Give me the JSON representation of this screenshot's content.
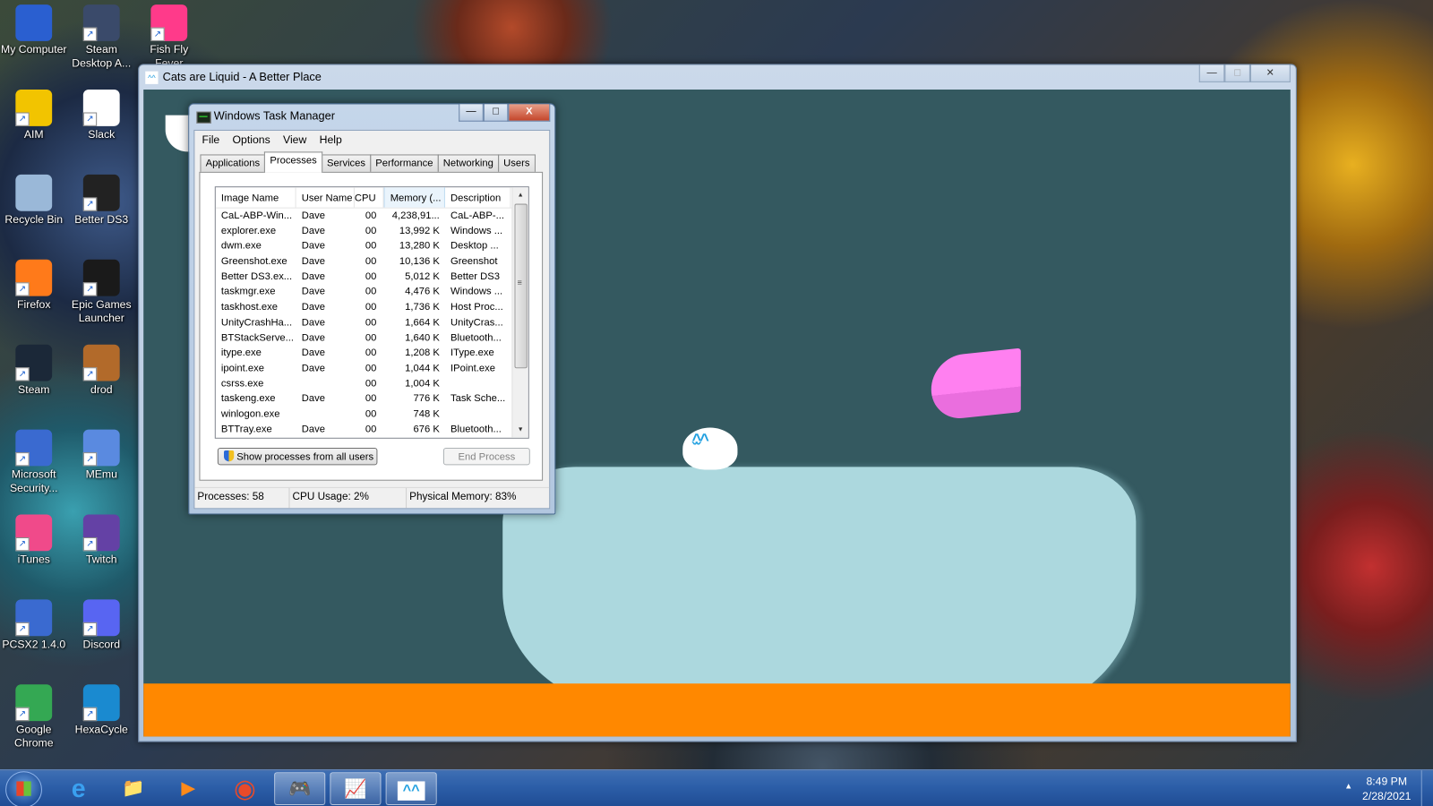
{
  "desktop": {
    "icons": [
      {
        "label": "My Computer",
        "icon": "computer-icon",
        "color": "#2a5fd0"
      },
      {
        "label": "Steam Desktop A...",
        "icon": "lock-icon",
        "color": "#3a4a6a"
      },
      {
        "label": "Fish Fly Fever Shortcut",
        "icon": "bell-icon",
        "color": "#ff3a8a"
      },
      {
        "label": "AIM",
        "icon": "running-man-icon",
        "color": "#f2c400"
      },
      {
        "label": "Slack",
        "icon": "slack-icon",
        "color": "#ffffff"
      },
      {
        "label": "Recycle Bin",
        "icon": "recycle-bin-icon",
        "color": "#9ab8d8"
      },
      {
        "label": "Better DS3",
        "icon": "gamepad-icon",
        "color": "#222222"
      },
      {
        "label": "Firefox",
        "icon": "firefox-icon",
        "color": "#ff7a1a"
      },
      {
        "label": "Epic Games Launcher",
        "icon": "epic-icon",
        "color": "#1a1a1a"
      },
      {
        "label": "Steam",
        "icon": "steam-icon",
        "color": "#1b2838"
      },
      {
        "label": "drod",
        "icon": "sword-icon",
        "color": "#b26a2a"
      },
      {
        "label": "Microsoft Security...",
        "icon": "castle-icon",
        "color": "#3a6ad0"
      },
      {
        "label": "MEmu",
        "icon": "memu-icon",
        "color": "#5a8ae0"
      },
      {
        "label": "iTunes",
        "icon": "music-note-icon",
        "color": "#f04a8a"
      },
      {
        "label": "Twitch",
        "icon": "twitch-icon",
        "color": "#6441a5"
      },
      {
        "label": "PCSX2 1.4.0",
        "icon": "ps2-icon",
        "color": "#3a6ad0"
      },
      {
        "label": "Discord",
        "icon": "discord-icon",
        "color": "#5865f2"
      },
      {
        "label": "Google Chrome",
        "icon": "chrome-icon",
        "color": "#34a853"
      },
      {
        "label": "HexaCycle",
        "icon": "hexagon-icon",
        "color": "#1a8ad0"
      }
    ]
  },
  "game_window": {
    "title": "Cats are Liquid - A Better Place",
    "minimize": "—",
    "maximize": "□",
    "close": "✕",
    "colors": {
      "background": "#345960",
      "floor": "#ff8800",
      "liquid": "#acd8de",
      "pink_block": "#ff80f0"
    }
  },
  "task_manager": {
    "title": "Windows Task Manager",
    "minimize": "—",
    "maximize": "□",
    "close": "X",
    "menu": [
      "File",
      "Options",
      "View",
      "Help"
    ],
    "tabs": [
      "Applications",
      "Processes",
      "Services",
      "Performance",
      "Networking",
      "Users"
    ],
    "active_tab": "Processes",
    "columns": [
      "Image Name",
      "User Name",
      "CPU",
      "Memory (...",
      "Description"
    ],
    "sorted_column": "Memory (...",
    "processes": [
      {
        "name": "CaL-ABP-Win...",
        "user": "Dave",
        "cpu": "00",
        "memory": "4,238,91...",
        "description": "CaL-ABP-..."
      },
      {
        "name": "explorer.exe",
        "user": "Dave",
        "cpu": "00",
        "memory": "13,992 K",
        "description": "Windows ..."
      },
      {
        "name": "dwm.exe",
        "user": "Dave",
        "cpu": "00",
        "memory": "13,280 K",
        "description": "Desktop ..."
      },
      {
        "name": "Greenshot.exe",
        "user": "Dave",
        "cpu": "00",
        "memory": "10,136 K",
        "description": "Greenshot"
      },
      {
        "name": "Better DS3.ex...",
        "user": "Dave",
        "cpu": "00",
        "memory": "5,012 K",
        "description": "Better DS3"
      },
      {
        "name": "taskmgr.exe",
        "user": "Dave",
        "cpu": "00",
        "memory": "4,476 K",
        "description": "Windows ..."
      },
      {
        "name": "taskhost.exe",
        "user": "Dave",
        "cpu": "00",
        "memory": "1,736 K",
        "description": "Host Proc..."
      },
      {
        "name": "UnityCrashHa...",
        "user": "Dave",
        "cpu": "00",
        "memory": "1,664 K",
        "description": "UnityCras..."
      },
      {
        "name": "BTStackServe...",
        "user": "Dave",
        "cpu": "00",
        "memory": "1,640 K",
        "description": "Bluetooth..."
      },
      {
        "name": "itype.exe",
        "user": "Dave",
        "cpu": "00",
        "memory": "1,208 K",
        "description": "IType.exe"
      },
      {
        "name": "ipoint.exe",
        "user": "Dave",
        "cpu": "00",
        "memory": "1,044 K",
        "description": "IPoint.exe"
      },
      {
        "name": "csrss.exe",
        "user": "",
        "cpu": "00",
        "memory": "1,004 K",
        "description": ""
      },
      {
        "name": "taskeng.exe",
        "user": "Dave",
        "cpu": "00",
        "memory": "776 K",
        "description": "Task Sche..."
      },
      {
        "name": "winlogon.exe",
        "user": "",
        "cpu": "00",
        "memory": "748 K",
        "description": ""
      },
      {
        "name": "BTTray.exe",
        "user": "Dave",
        "cpu": "00",
        "memory": "676 K",
        "description": "Bluetooth..."
      }
    ],
    "show_all_button": "Show processes from all users",
    "end_process_button": "End Process",
    "status": {
      "processes": "Processes: 58",
      "cpu": "CPU Usage: 2%",
      "memory": "Physical Memory: 83%"
    }
  },
  "taskbar": {
    "start": "Start",
    "items": [
      {
        "name": "internet-explorer",
        "glyph": "e",
        "open": false
      },
      {
        "name": "file-explorer",
        "glyph": "📁",
        "open": false
      },
      {
        "name": "media-player",
        "glyph": "▶",
        "open": false
      },
      {
        "name": "chrome",
        "glyph": "◉",
        "open": false
      },
      {
        "name": "better-ds3",
        "glyph": "🎮",
        "open": true
      },
      {
        "name": "task-manager",
        "glyph": "📈",
        "open": true
      },
      {
        "name": "cats-are-liquid",
        "glyph": "^^",
        "open": true
      }
    ],
    "tray_toggle": "▲",
    "time": "8:49 PM",
    "date": "2/28/2021"
  }
}
